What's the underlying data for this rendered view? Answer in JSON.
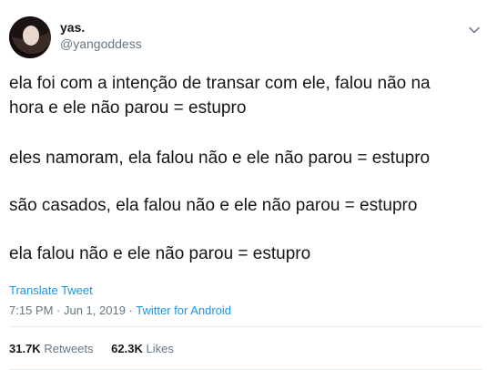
{
  "user": {
    "display_name": "yas.",
    "handle": "@yangoddess"
  },
  "tweet": {
    "line1": "ela foi com a intenção de transar com ele, falou não na",
    "line2": "hora e ele não parou = estupro",
    "para2": "eles namoram, ela falou não e ele não parou = estupro",
    "para3": "são casados, ela falou não e ele não parou = estupro",
    "para4": "ela falou não e ele não parou = estupro"
  },
  "translate_label": "Translate Tweet",
  "meta": {
    "time": "7:15 PM",
    "separator": " · ",
    "date": "Jun 1, 2019",
    "separator2": " · ",
    "source": "Twitter for Android"
  },
  "stats": {
    "retweets_count": "31.7K",
    "retweets_label": "Retweets",
    "likes_count": "62.3K",
    "likes_label": "Likes"
  },
  "icons": {
    "menu": "chevron-down-icon"
  }
}
